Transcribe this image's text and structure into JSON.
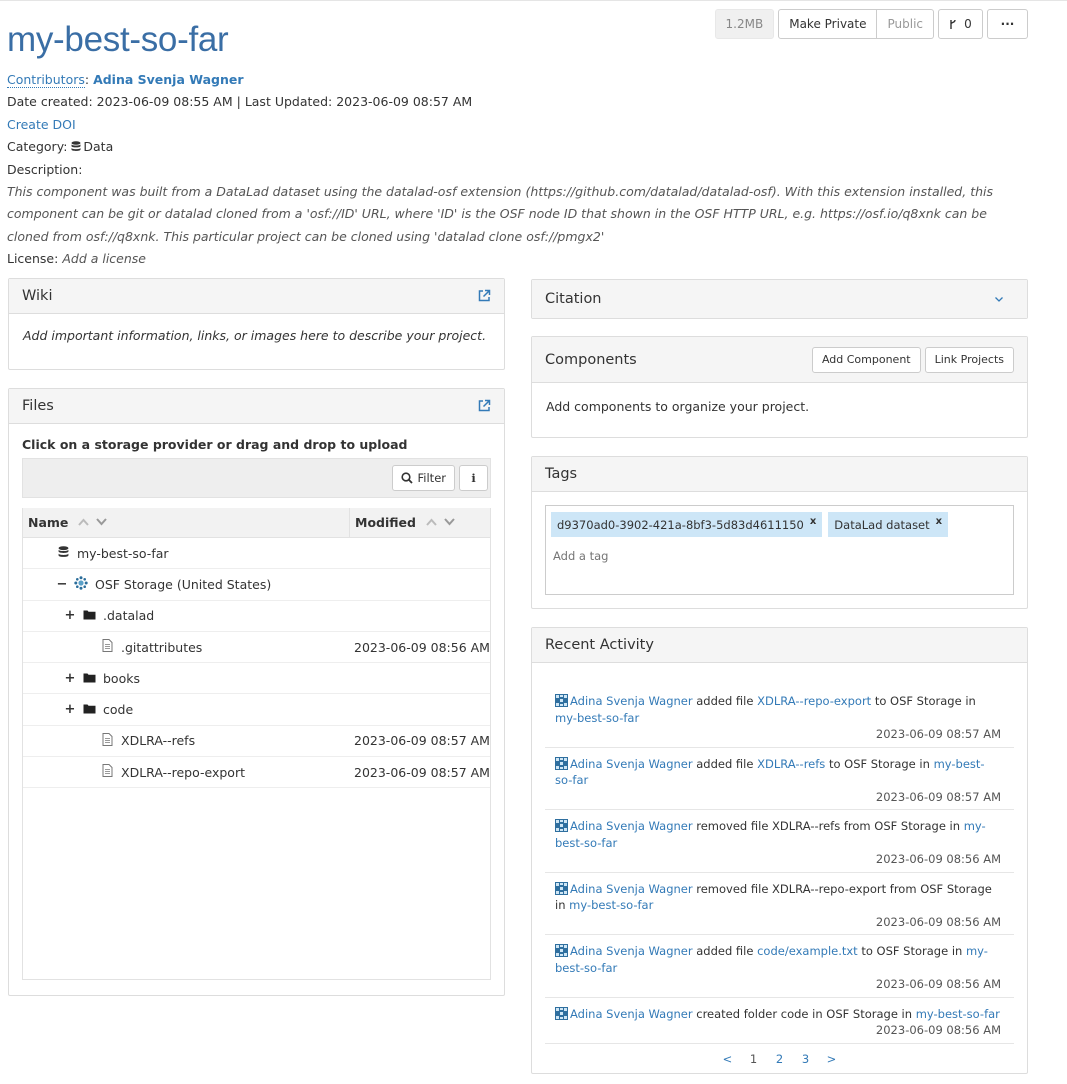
{
  "header": {
    "title": "my-best-so-far",
    "size_badge": "1.2MB",
    "make_private_label": "Make Private",
    "public_label": "Public",
    "fork_count": "0",
    "more_label": "···"
  },
  "meta": {
    "contributors_label": "Contributors",
    "contributor_name": "Adina Svenja Wagner",
    "date_created_label": "Date created:",
    "date_created": "2023-06-09 08:55 AM",
    "separator": "|",
    "last_updated_label": "Last Updated:",
    "last_updated": "2023-06-09 08:57 AM",
    "create_doi": "Create DOI",
    "category_label": "Category:",
    "category_value": "Data",
    "description_label": "Description:",
    "description": "This component was built from a DataLad dataset using the datalad-osf extension (https://github.com/datalad/datalad-osf). With this extension installed, this component can be git or datalad cloned from a 'osf://ID' URL, where 'ID' is the OSF node ID that shown in the OSF HTTP URL, e.g. https://osf.io/q8xnk can be cloned from osf://q8xnk. This particular project can be cloned using 'datalad clone osf://pmgx2'",
    "license_label": "License:",
    "license_value": "Add a license"
  },
  "wiki": {
    "title": "Wiki",
    "body": "Add important information, links, or images here to describe your project."
  },
  "files": {
    "title": "Files",
    "hint": "Click on a storage provider or drag and drop to upload",
    "filter_label": "Filter",
    "info_label": "i",
    "col_name": "Name",
    "col_modified": "Modified",
    "rows": [
      {
        "name": "my-best-so-far",
        "modified": "",
        "toggle": "",
        "icon": "database-icon"
      },
      {
        "name": "OSF Storage (United States)",
        "modified": "",
        "toggle": "−",
        "icon": "osf-storage-icon"
      },
      {
        "name": ".datalad",
        "modified": "",
        "toggle": "+",
        "icon": "folder-icon"
      },
      {
        "name": ".gitattributes",
        "modified": "2023-06-09 08:56 AM",
        "toggle": "",
        "icon": "file-icon"
      },
      {
        "name": "books",
        "modified": "",
        "toggle": "+",
        "icon": "folder-icon"
      },
      {
        "name": "code",
        "modified": "",
        "toggle": "+",
        "icon": "folder-icon"
      },
      {
        "name": "XDLRA--refs",
        "modified": "2023-06-09 08:57 AM",
        "toggle": "",
        "icon": "file-icon"
      },
      {
        "name": "XDLRA--repo-export",
        "modified": "2023-06-09 08:57 AM",
        "toggle": "",
        "icon": "file-icon"
      }
    ]
  },
  "citation": {
    "title": "Citation"
  },
  "components": {
    "title": "Components",
    "add_label": "Add Component",
    "link_label": "Link Projects",
    "body": "Add components to organize your project."
  },
  "tags": {
    "title": "Tags",
    "items": [
      "d9370ad0-3902-421a-8bf3-5d83d4611150",
      "DataLad dataset"
    ],
    "remove_label": "x",
    "placeholder": "Add a tag"
  },
  "activity": {
    "title": "Recent Activity",
    "items": [
      {
        "user": "Adina Svenja Wagner",
        "action": "added file",
        "target": "XDLRA--repo-export",
        "mid": "to OSF Storage in",
        "project": "my-best-so-far",
        "time": "2023-06-09 08:57 AM"
      },
      {
        "user": "Adina Svenja Wagner",
        "action": "added file",
        "target": "XDLRA--refs",
        "mid": "to OSF Storage in",
        "project": "my-best-so-far",
        "time": "2023-06-09 08:57 AM"
      },
      {
        "user": "Adina Svenja Wagner",
        "action": "removed file XDLRA--refs from OSF Storage in",
        "target": "",
        "mid": "",
        "project": "my-best-so-far",
        "time": "2023-06-09 08:56 AM"
      },
      {
        "user": "Adina Svenja Wagner",
        "action": "removed file XDLRA--repo-export from OSF Storage in",
        "target": "",
        "mid": "",
        "project": "my-best-so-far",
        "time": "2023-06-09 08:56 AM"
      },
      {
        "user": "Adina Svenja Wagner",
        "action": "added file",
        "target": "code/example.txt",
        "mid": "to OSF Storage in",
        "project": "my-best-so-far",
        "time": "2023-06-09 08:56 AM"
      },
      {
        "user": "Adina Svenja Wagner",
        "action": "created folder code in OSF Storage in",
        "target": "",
        "mid": "",
        "project": "my-best-so-far",
        "time": "2023-06-09 08:56 AM"
      }
    ],
    "pager": [
      "<",
      "1",
      "2",
      "3",
      ">"
    ]
  }
}
